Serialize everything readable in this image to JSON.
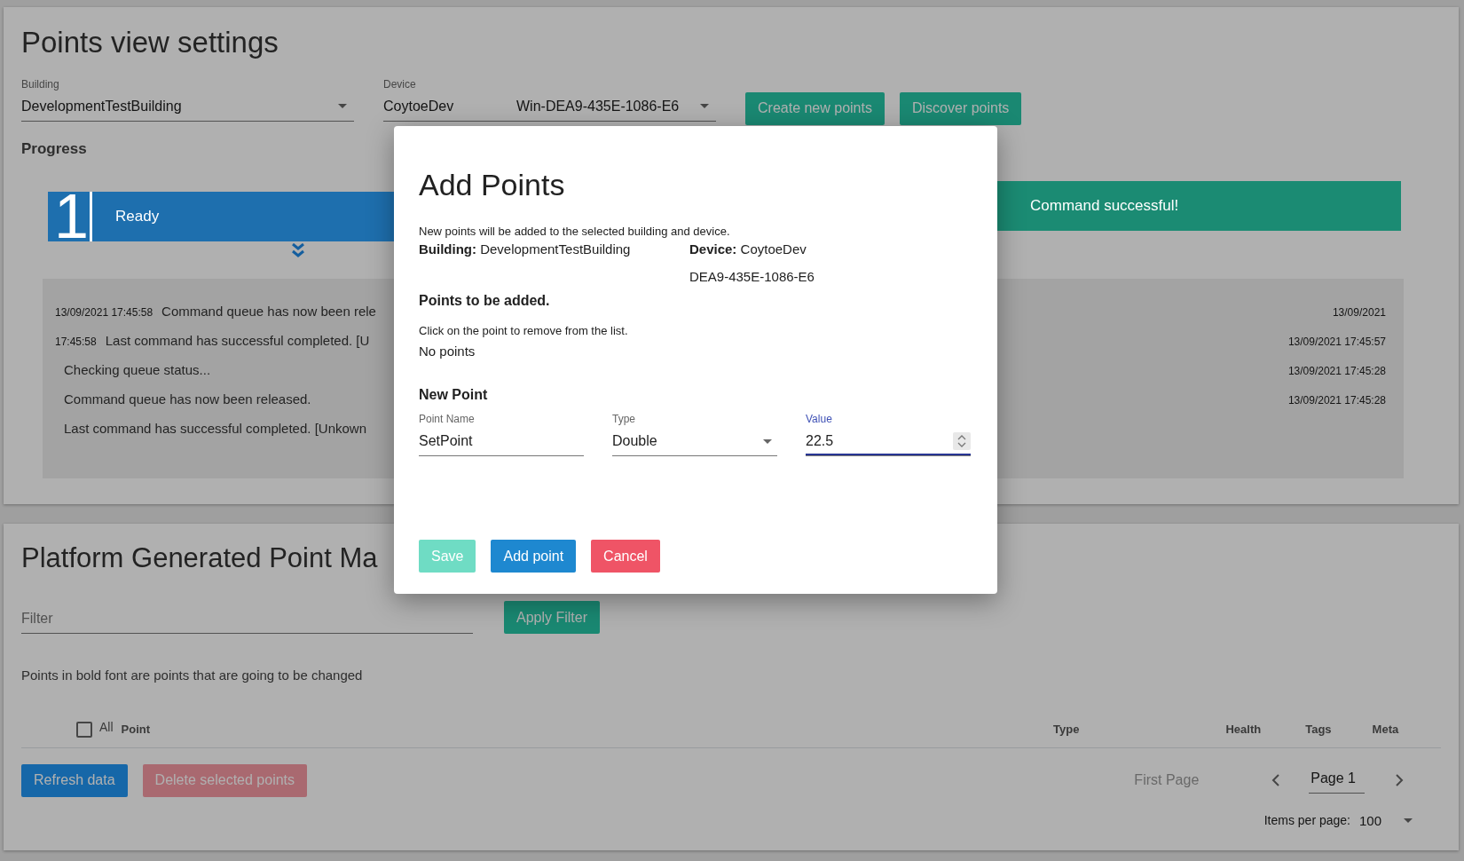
{
  "settings": {
    "title": "Points view settings",
    "building": {
      "label": "Building",
      "value": "DevelopmentTestBuilding"
    },
    "device": {
      "label": "Device",
      "value": "CoytoeDev",
      "detail": "Win-DEA9-435E-1086-E6"
    },
    "buttons": [
      {
        "label": "Create new points"
      },
      {
        "label": "Discover points"
      }
    ],
    "progress_title": "Progress",
    "steps": [
      {
        "number": "1",
        "label": "Ready",
        "color": "#1e6fae"
      },
      {
        "label": "Command successful!",
        "color": "#1b8b73"
      }
    ],
    "log": [
      {
        "time": "13/09/2021 17:45:58",
        "message": "Command queue has now been rele",
        "timestamp": "13/09/2021"
      },
      {
        "time": "17:45:58",
        "message": "Last command has successful completed. [U",
        "timestamp": "13/09/2021 17:45:57"
      },
      {
        "message": "Checking queue status...",
        "timestamp": "13/09/2021 17:45:28"
      },
      {
        "message": "Command queue has now been released.",
        "timestamp": "13/09/2021 17:45:28"
      },
      {
        "message": "Last command has successful completed. [Unkown"
      }
    ]
  },
  "mapping": {
    "title": "Platform Generated Point Ma",
    "filter": {
      "placeholder": "Filter"
    },
    "apply_button": "Apply Filter",
    "note": "Points in bold font are points that are going to be changed",
    "select_all": {
      "label": "All",
      "checked": false
    },
    "columns": [
      "Point",
      "Type",
      "Health",
      "Tags",
      "Meta"
    ],
    "buttons": [
      {
        "label": "Refresh data",
        "disabled": false
      },
      {
        "label": "Delete selected points",
        "disabled": true
      }
    ],
    "pager": {
      "first": {
        "label": "First Page",
        "disabled": true
      },
      "page": "Page 1",
      "items_label": "Items per page:",
      "items_value": "100"
    }
  },
  "dialog": {
    "title": "Add Points",
    "intro": "New points will be added to the selected building and device.",
    "building": "**Building:** DevelopmentTestBuilding",
    "device": "**Device:** CoytoeDev",
    "device_id": "DEA9-435E-1086-E6",
    "list_title": "Points to be added.",
    "list_hint": "Click on the point to remove from the list.",
    "list_empty": "No points",
    "new_title": "New Point",
    "fields": [
      {
        "kind": "text",
        "label": "Point Name",
        "value": "SetPoint",
        "focused": false
      },
      {
        "kind": "select",
        "label": "Type",
        "value": "Double",
        "focused": false
      },
      {
        "kind": "number",
        "label": "Value",
        "value": "22.5",
        "focused": true
      }
    ],
    "buttons": [
      {
        "label": "Save",
        "disabled": true
      },
      {
        "label": "Add point",
        "disabled": false
      },
      {
        "label": "Cancel",
        "disabled": false
      }
    ]
  }
}
